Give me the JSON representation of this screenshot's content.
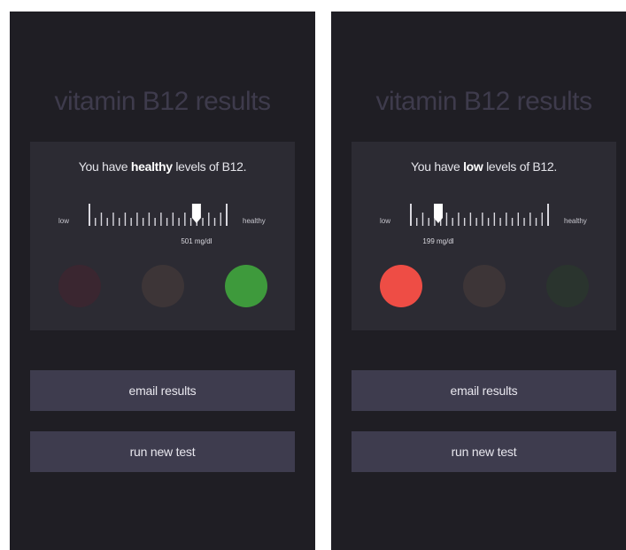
{
  "screens": [
    {
      "title": "vitamin B12 results",
      "status_prefix": "You have ",
      "status_level": "healthy",
      "status_suffix": " levels of B12.",
      "scale_low_label": "low",
      "scale_high_label": "healthy",
      "reading": "501 mg/dl",
      "marker_position_fraction": 0.78,
      "indicators": [
        {
          "name": "red",
          "color": "#3a2630"
        },
        {
          "name": "amber",
          "color": "#3d3537"
        },
        {
          "name": "green",
          "color": "#3e9a3c"
        }
      ],
      "email_label": "email results",
      "run_label": "run new test"
    },
    {
      "title": "vitamin B12 results",
      "status_prefix": "You have ",
      "status_level": "low",
      "status_suffix": " levels of B12.",
      "scale_low_label": "low",
      "scale_high_label": "healthy",
      "reading": "199 mg/dl",
      "marker_position_fraction": 0.2,
      "indicators": [
        {
          "name": "red",
          "color": "#ee4d45"
        },
        {
          "name": "amber",
          "color": "#3d3537"
        },
        {
          "name": "green",
          "color": "#2a342e"
        }
      ],
      "email_label": "email results",
      "run_label": "run new test"
    }
  ]
}
